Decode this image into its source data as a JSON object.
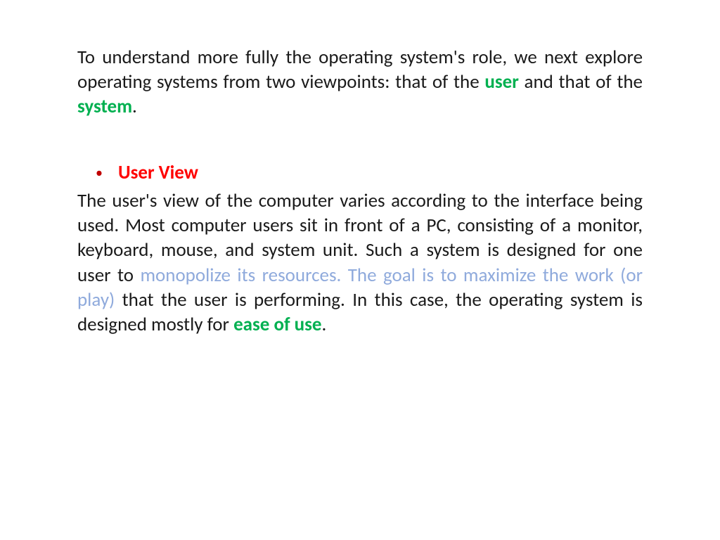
{
  "intro": {
    "part1": "To understand more fully the operating system's role, we next explore operating systems from two viewpoints:  that of the ",
    "kw1": "user",
    "part2": " and that of the ",
    "kw2": "system",
    "part3": "."
  },
  "heading": "User View",
  "body": {
    "p1": "The user's view of the computer varies according to the interface being used. Most computer users sit in front of a PC, consisting of a monitor, keyboard, mouse, and system unit. Such a system is designed for one user to ",
    "blue": "monopolize its resources. The goal is to maximize the work (or play)",
    "p2": " that the user is performing. In this case, the operating system is designed mostly for ",
    "green": "ease of use",
    "p3": "."
  }
}
